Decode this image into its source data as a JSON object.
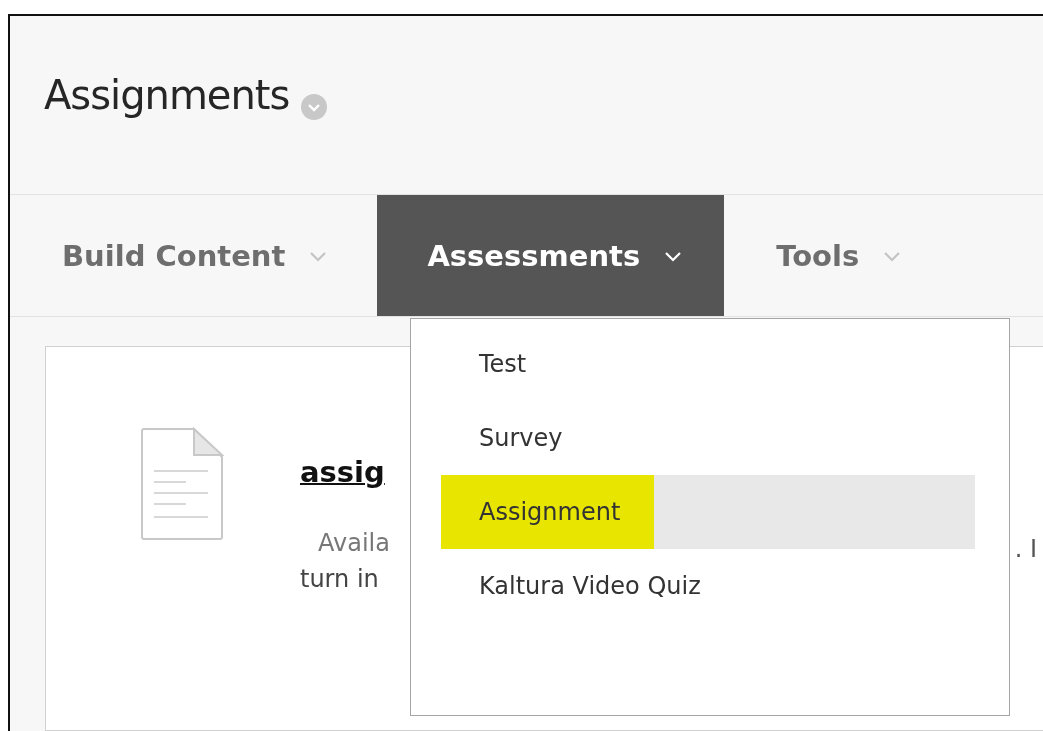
{
  "page": {
    "title": "Assignments"
  },
  "tabs": [
    {
      "label": "Build Content",
      "selected": false
    },
    {
      "label": "Assessments",
      "selected": true
    },
    {
      "label": "Tools",
      "selected": false
    }
  ],
  "menu": {
    "items": [
      {
        "label": "Test",
        "selected": false
      },
      {
        "label": "Survey",
        "selected": false
      },
      {
        "label": "Assignment",
        "selected": true
      },
      {
        "label": "Kaltura Video Quiz",
        "selected": false
      }
    ]
  },
  "content_item": {
    "title": "assig",
    "line_1": "Availa",
    "line_1_end": ". I",
    "line_2": "turn in"
  }
}
